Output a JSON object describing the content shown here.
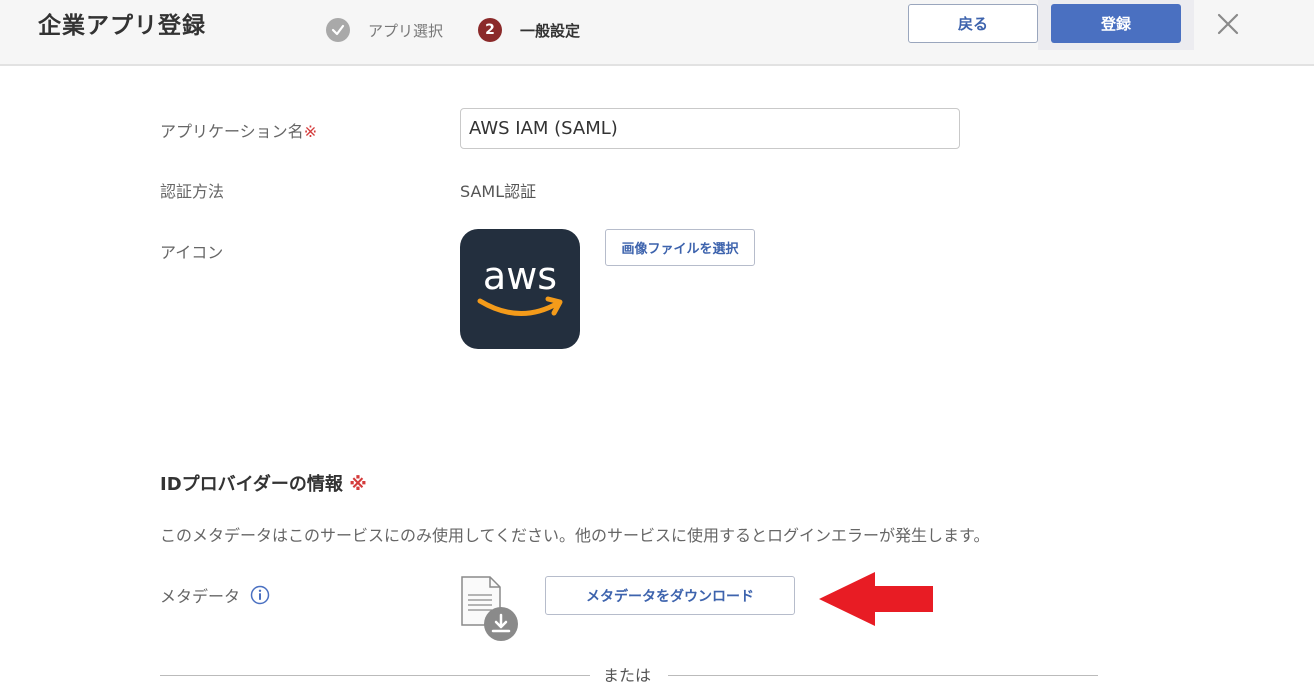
{
  "header": {
    "title": "企業アプリ登録",
    "steps": [
      {
        "number": "✓",
        "label": "アプリ選択",
        "state": "done"
      },
      {
        "number": "2",
        "label": "一般設定",
        "state": "active"
      }
    ],
    "back_label": "戻る",
    "register_label": "登録"
  },
  "form": {
    "app_name_label": "アプリケーション名",
    "required_mark": "※",
    "app_name_value": "AWS IAM (SAML)",
    "auth_label": "認証方法",
    "auth_value": "SAML認証",
    "icon_label": "アイコン",
    "select_image_label": "画像ファイルを選択",
    "logo_text": "aws"
  },
  "idp": {
    "title": "IDプロバイダーの情報",
    "required_mark": "※",
    "note": "このメタデータはこのサービスにのみ使用してください。他のサービスに使用するとログインエラーが発生します。",
    "metadata_label": "メタデータ",
    "download_label": "メタデータをダウンロード",
    "or_text": "または"
  },
  "colors": {
    "accent": "#4a70c1",
    "step_active": "#8b2a2a",
    "arrow": "#e81c24",
    "logo_bg": "#232f3e",
    "logo_smile": "#f49b1a"
  }
}
